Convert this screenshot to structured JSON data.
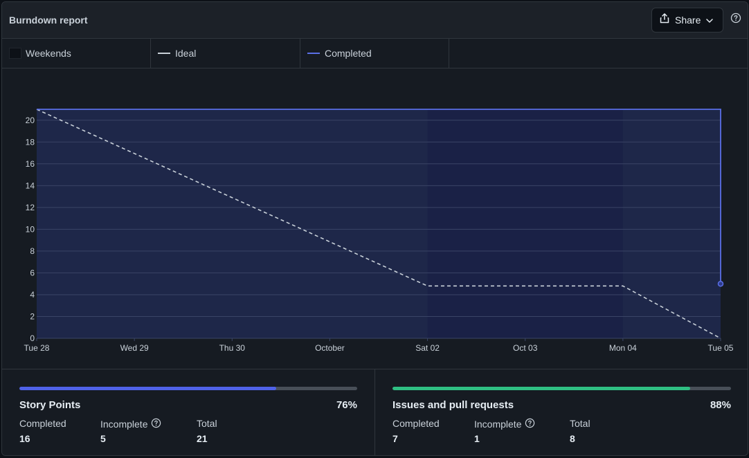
{
  "header": {
    "title": "Burndown report",
    "share_label": "Share"
  },
  "legend": [
    {
      "label": "Weekends"
    },
    {
      "label": "Ideal",
      "color": "#c9d1d9"
    },
    {
      "label": "Completed",
      "color": "#5a6fe6"
    }
  ],
  "chart_data": {
    "type": "line",
    "x_ticks": [
      "Tue 28",
      "Wed 29",
      "Thu 30",
      "October",
      "Sat 02",
      "Oct 03",
      "Mon 04",
      "Tue 05"
    ],
    "y_ticks": [
      0,
      2,
      4,
      6,
      8,
      10,
      12,
      14,
      16,
      18,
      20
    ],
    "ylim": [
      0,
      21
    ],
    "weekend_range": [
      "Sat 02",
      "Mon 04"
    ],
    "series": [
      {
        "name": "Ideal",
        "style": "dashed",
        "color": "#c9d1d9",
        "points": [
          [
            "Tue 28",
            21
          ],
          [
            "Sat 02",
            4.8
          ],
          [
            "Mon 04",
            4.8
          ],
          [
            "Tue 05",
            0
          ]
        ]
      },
      {
        "name": "Completed",
        "style": "solid",
        "color": "#5a6fe6",
        "points": [
          [
            "Tue 28",
            21
          ],
          [
            "Tue 05",
            21
          ],
          [
            "Tue 05",
            5
          ],
          [
            "end",
            5
          ]
        ]
      }
    ]
  },
  "stats": [
    {
      "title": "Story Points",
      "percent": "76%",
      "progress": 0.76,
      "bar_color": "#4f62e8",
      "completed_label": "Completed",
      "completed": "16",
      "incomplete_label": "Incomplete",
      "incomplete": "5",
      "total_label": "Total",
      "total": "21"
    },
    {
      "title": "Issues and pull requests",
      "percent": "88%",
      "progress": 0.88,
      "bar_color": "#2fbf83",
      "completed_label": "Completed",
      "completed": "7",
      "incomplete_label": "Incomplete",
      "incomplete": "1",
      "total_label": "Total",
      "total": "8"
    }
  ]
}
